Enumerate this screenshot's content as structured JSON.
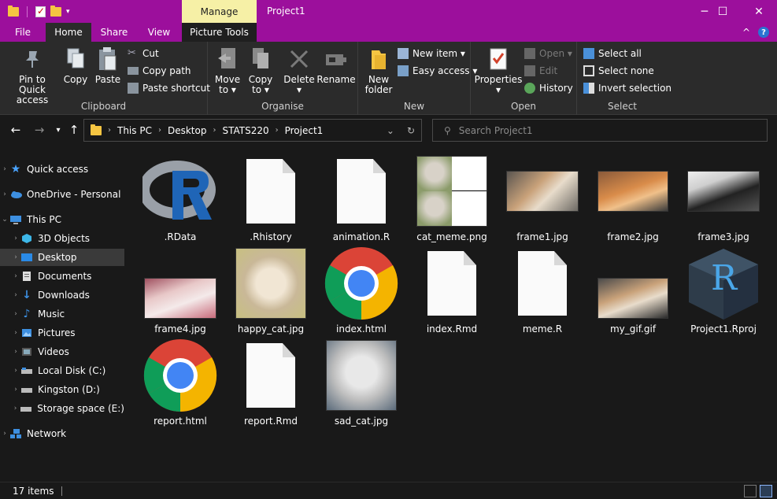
{
  "window": {
    "title": "Project1",
    "context_tab": "Manage",
    "controls": {
      "minimize": "─",
      "maximize": "☐",
      "close": "✕"
    }
  },
  "ribbon_tabs": {
    "file": "File",
    "home": "Home",
    "share": "Share",
    "view": "View",
    "picture_tools": "Picture Tools",
    "collapse": "^",
    "help": "?"
  },
  "ribbon": {
    "clipboard": {
      "label": "Clipboard",
      "pin_line1": "Pin to Quick",
      "pin_line2": "access",
      "copy": "Copy",
      "paste": "Paste",
      "cut": "Cut",
      "copy_path": "Copy path",
      "paste_shortcut": "Paste shortcut"
    },
    "organise": {
      "label": "Organise",
      "move_to_line1": "Move",
      "move_to_line2": "to ▾",
      "copy_to_line1": "Copy",
      "copy_to_line2": "to ▾",
      "delete": "Delete",
      "delete_arrow": "▾",
      "rename": "Rename"
    },
    "new": {
      "label": "New",
      "new_folder_line1": "New",
      "new_folder_line2": "folder",
      "new_item": "New item ▾",
      "easy_access": "Easy access ▾"
    },
    "open": {
      "label": "Open",
      "properties": "Properties",
      "properties_arrow": "▾",
      "open": "Open ▾",
      "edit": "Edit",
      "history": "History"
    },
    "select": {
      "label": "Select",
      "select_all": "Select all",
      "select_none": "Select none",
      "invert_selection": "Invert selection"
    }
  },
  "address": {
    "crumbs": [
      "This PC",
      "Desktop",
      "STATS220",
      "Project1"
    ],
    "search_placeholder": "Search Project1"
  },
  "sidebar": {
    "items": [
      {
        "label": "Quick access",
        "icon": "star-icon"
      },
      {
        "label": "OneDrive - Personal",
        "icon": "cloud-icon"
      },
      {
        "label": "This PC",
        "icon": "computer-icon"
      },
      {
        "label": "3D Objects",
        "icon": "cube-icon"
      },
      {
        "label": "Desktop",
        "icon": "desktop-icon"
      },
      {
        "label": "Documents",
        "icon": "documents-icon"
      },
      {
        "label": "Downloads",
        "icon": "download-icon"
      },
      {
        "label": "Music",
        "icon": "music-icon"
      },
      {
        "label": "Pictures",
        "icon": "pictures-icon"
      },
      {
        "label": "Videos",
        "icon": "videos-icon"
      },
      {
        "label": "Local Disk (C:)",
        "icon": "drive-icon"
      },
      {
        "label": "Kingston (D:)",
        "icon": "drive-icon"
      },
      {
        "label": "Storage space (E:)",
        "icon": "drive-icon"
      },
      {
        "label": "Network",
        "icon": "network-icon"
      }
    ]
  },
  "files": [
    {
      "name": ".RData",
      "type": "r-logo"
    },
    {
      "name": ".Rhistory",
      "type": "blank"
    },
    {
      "name": "animation.R",
      "type": "blank"
    },
    {
      "name": "cat_meme.png",
      "type": "meme"
    },
    {
      "name": "frame1.jpg",
      "type": "photo"
    },
    {
      "name": "frame2.jpg",
      "type": "photo"
    },
    {
      "name": "frame3.jpg",
      "type": "photo"
    },
    {
      "name": "frame4.jpg",
      "type": "photo"
    },
    {
      "name": "happy_cat.jpg",
      "type": "photo"
    },
    {
      "name": "index.html",
      "type": "chrome"
    },
    {
      "name": "index.Rmd",
      "type": "blank"
    },
    {
      "name": "meme.R",
      "type": "blank"
    },
    {
      "name": "my_gif.gif",
      "type": "photo"
    },
    {
      "name": "Project1.Rproj",
      "type": "rproj"
    },
    {
      "name": "report.html",
      "type": "chrome"
    },
    {
      "name": "report.Rmd",
      "type": "blank"
    },
    {
      "name": "sad_cat.jpg",
      "type": "photo"
    }
  ],
  "status": {
    "count": "17 items"
  }
}
